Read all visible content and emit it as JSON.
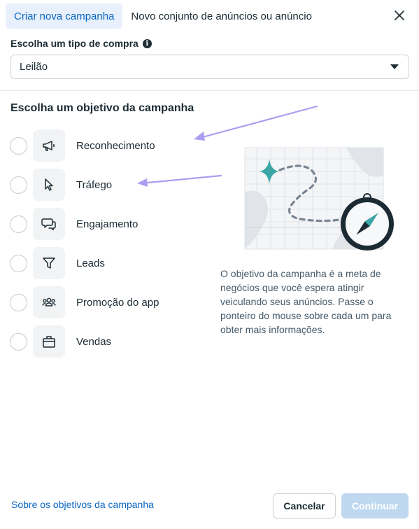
{
  "tabs": [
    {
      "label": "Criar nova campanha",
      "active": true
    },
    {
      "label": "Novo conjunto de anúncios ou anúncio",
      "active": false
    }
  ],
  "close_icon": "close-icon",
  "purchase": {
    "label": "Escolha um tipo de compra",
    "info_glyph": "i",
    "selected": "Leilão"
  },
  "objectives": {
    "title": "Escolha um objetivo da campanha",
    "items": [
      {
        "label": "Reconhecimento",
        "icon": "megaphone-icon"
      },
      {
        "label": "Tráfego",
        "icon": "cursor-icon"
      },
      {
        "label": "Engajamento",
        "icon": "chat-bubbles-icon"
      },
      {
        "label": "Leads",
        "icon": "funnel-icon"
      },
      {
        "label": "Promoção do app",
        "icon": "people-icon"
      },
      {
        "label": "Vendas",
        "icon": "shopping-bag-icon"
      }
    ]
  },
  "description": "O objetivo da campanha é a meta de negócios que você espera atingir veiculando seus anúncios. Passe o ponteiro do mouse sobre cada um para obter mais informações.",
  "footer": {
    "link": "Sobre os objetivos da campanha",
    "cancel": "Cancelar",
    "continue": "Continuar"
  },
  "colors": {
    "accent": "#0a66c2",
    "active_tab_bg": "#e7f0fb",
    "disabled_button": "#bed8f0",
    "annotation_arrow": "#a99ef0",
    "map_pin": "#3aa6a6"
  }
}
